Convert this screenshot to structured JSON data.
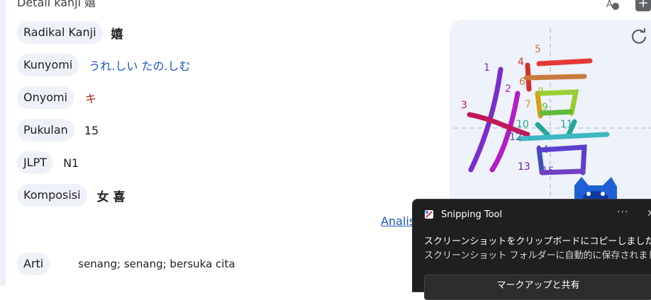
{
  "header": {
    "title": "Detail kanji 嬉"
  },
  "rows": [
    {
      "label": "Radikal Kanji",
      "value": "嬉"
    },
    {
      "label": "Kunyomi",
      "value": "うれ.しい  たの.しむ"
    },
    {
      "label": "Onyomi",
      "value": "キ"
    },
    {
      "label": "Pukulan",
      "value": "15"
    },
    {
      "label": "JLPT",
      "value": "N1"
    },
    {
      "label": "Komposisi",
      "value": "女 喜"
    }
  ],
  "analysis_link": "Analis",
  "meaning": {
    "label": "Arti",
    "value": "senang; senang; bersuka cita"
  },
  "stroke_numbers": [
    "1",
    "2",
    "3",
    "4",
    "5",
    "6",
    "7",
    "8",
    "9",
    "10",
    "11",
    "12",
    "13",
    "14",
    "15"
  ],
  "toast": {
    "app_name": "Snipping Tool",
    "more": "···",
    "close": "✕",
    "line1": "スクリーンショットをクリップボードにコピーしました",
    "line2": "スクリーンショット フォルダーに自動的に保存されました。",
    "action": "マークアップと共有"
  },
  "icons": {
    "plus": "+",
    "translate": "A"
  }
}
